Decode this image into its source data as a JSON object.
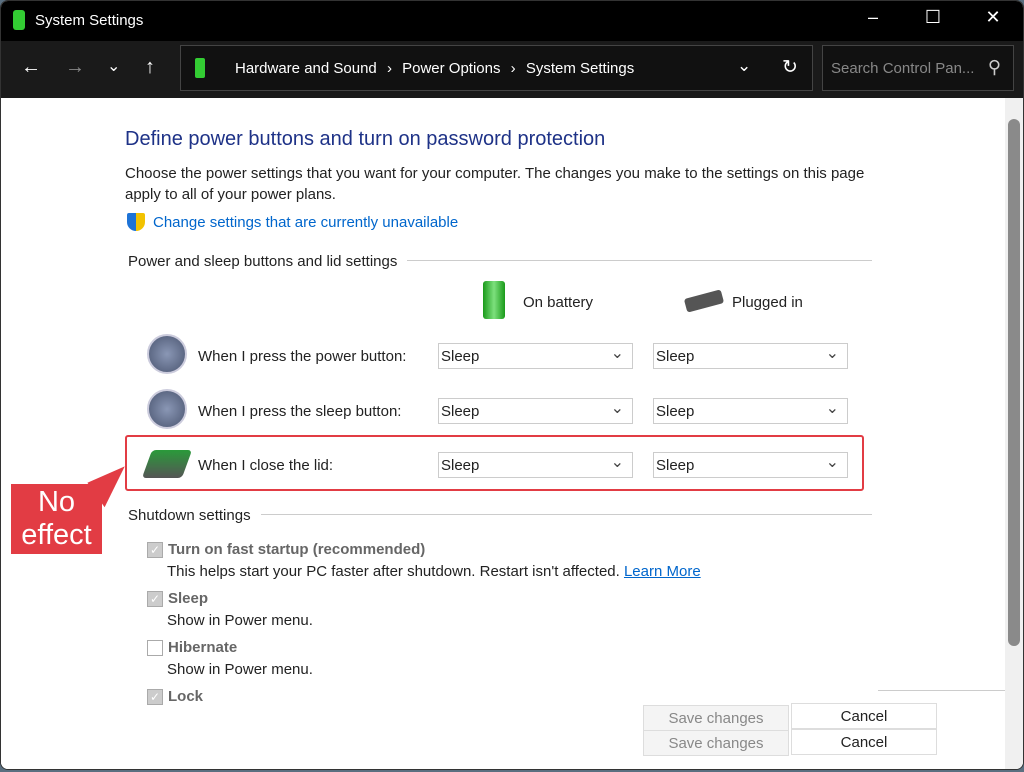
{
  "window": {
    "title": "System Settings",
    "minimize": "–",
    "maximize": "☐",
    "close": "✕"
  },
  "nav": {
    "back": "←",
    "forward": "→",
    "recent": "⌄",
    "up": "↑",
    "refresh": "↻",
    "dropdown": "⌄",
    "breadcrumbs": [
      "Hardware and Sound",
      "›",
      "Power Options",
      "›",
      "System Settings"
    ],
    "search_placeholder": "Search Control Pan...",
    "search_icon": "⚲"
  },
  "page": {
    "title": "Define power buttons and turn on password protection",
    "description": "Choose the power settings that you want for your computer. The changes you make to the settings on this page apply to all of your power plans.",
    "change_link": "Change settings that are currently unavailable",
    "section1": "Power and sleep buttons and lid settings",
    "col_battery": "On battery",
    "col_plugged": "Plugged in",
    "rows": [
      {
        "label": "When I press the power button:",
        "battery": "Sleep",
        "plugged": "Sleep"
      },
      {
        "label": "When I press the sleep button:",
        "battery": "Sleep",
        "plugged": "Sleep"
      },
      {
        "label": "When I close the lid:",
        "battery": "Sleep",
        "plugged": "Sleep"
      }
    ],
    "callout": "No effect",
    "section2": "Shutdown settings",
    "options": [
      {
        "label": "Turn on fast startup (recommended)",
        "desc": "This helps start your PC faster after shutdown. Restart isn't affected.",
        "link": "Learn More",
        "checked": true
      },
      {
        "label": "Sleep",
        "desc": "Show in Power menu.",
        "checked": true
      },
      {
        "label": "Hibernate",
        "desc": "Show in Power menu.",
        "checked": false
      },
      {
        "label": "Lock",
        "checked": true
      }
    ],
    "save": "Save changes",
    "cancel": "Cancel"
  },
  "colors": {
    "accent": "#1e3287",
    "highlight": "#e23c44",
    "link": "#0066cc"
  }
}
